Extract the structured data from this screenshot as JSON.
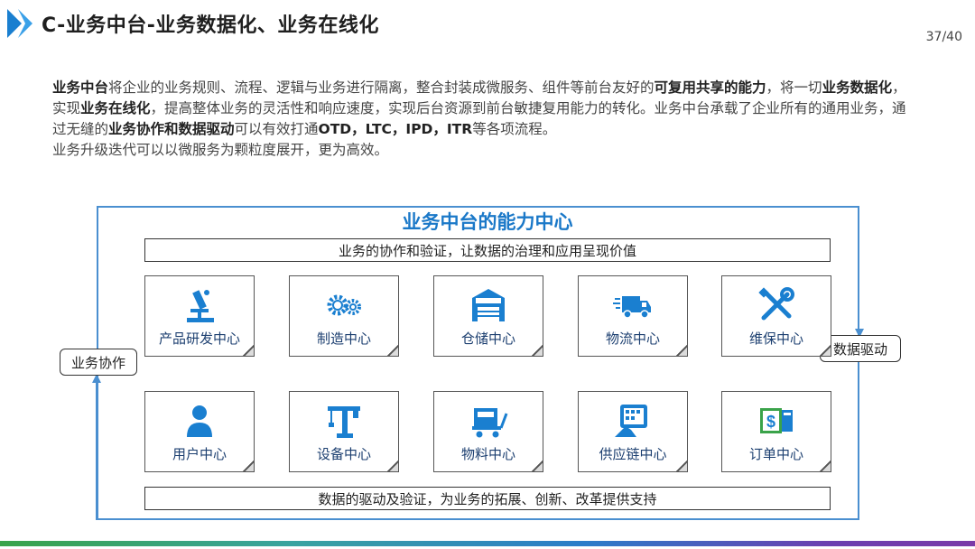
{
  "header": {
    "title": "C-业务中台-业务数据化、业务在线化",
    "page_number": "37/40"
  },
  "intro": [
    {
      "t": "业务中台",
      "b": true
    },
    {
      "t": "将企业的业务规则、流程、逻辑与业务进行隔离，整合封装成微服务、组件等前台友好的",
      "b": false
    },
    {
      "t": "可复用共享的能力",
      "b": true
    },
    {
      "t": "，将一切",
      "b": false
    },
    {
      "t": "业务数据化",
      "b": true
    },
    {
      "t": "，实现",
      "b": false
    },
    {
      "t": "业务在线化",
      "b": true
    },
    {
      "t": "，提高整体业务的灵活性和响应速度，实现后台资源到前台敏捷复用能力的转化。业务中台承载了企业所有的通用业务，通过无缝的",
      "b": false
    },
    {
      "t": "业务协作和数据驱动",
      "b": true
    },
    {
      "t": "可以有效打通",
      "b": false
    },
    {
      "t": "OTD，LTC，IPD，ITR",
      "b": true
    },
    {
      "t": "等各项流程。",
      "b": false
    },
    {
      "t": "业务升级迭代可以以微服务为颗粒度展开，更为高效。",
      "b": false,
      "br": true
    }
  ],
  "diagram": {
    "title": "业务中台的能力中心",
    "top_bar": "业务的协作和验证，让数据的治理和应用呈现价值",
    "bottom_bar": "数据的驱动及验证，为业务的拓展、创新、改革提供支持",
    "left_label": "业务协作",
    "right_label": "数据驱动",
    "row1": [
      {
        "label": "产品研发中心",
        "icon": "microscope-icon"
      },
      {
        "label": "制造中心",
        "icon": "gears-icon"
      },
      {
        "label": "仓储中心",
        "icon": "warehouse-icon"
      },
      {
        "label": "物流中心",
        "icon": "delivery-truck-icon"
      },
      {
        "label": "维保中心",
        "icon": "tools-icon"
      }
    ],
    "row2": [
      {
        "label": "用户中心",
        "icon": "user-icon"
      },
      {
        "label": "设备中心",
        "icon": "crane-icon"
      },
      {
        "label": "物料中心",
        "icon": "cart-icon"
      },
      {
        "label": "供应链中心",
        "icon": "touchscreen-icon"
      },
      {
        "label": "订单中心",
        "icon": "dollar-bill-icon"
      }
    ],
    "icon_color": "#1a7fd0"
  }
}
